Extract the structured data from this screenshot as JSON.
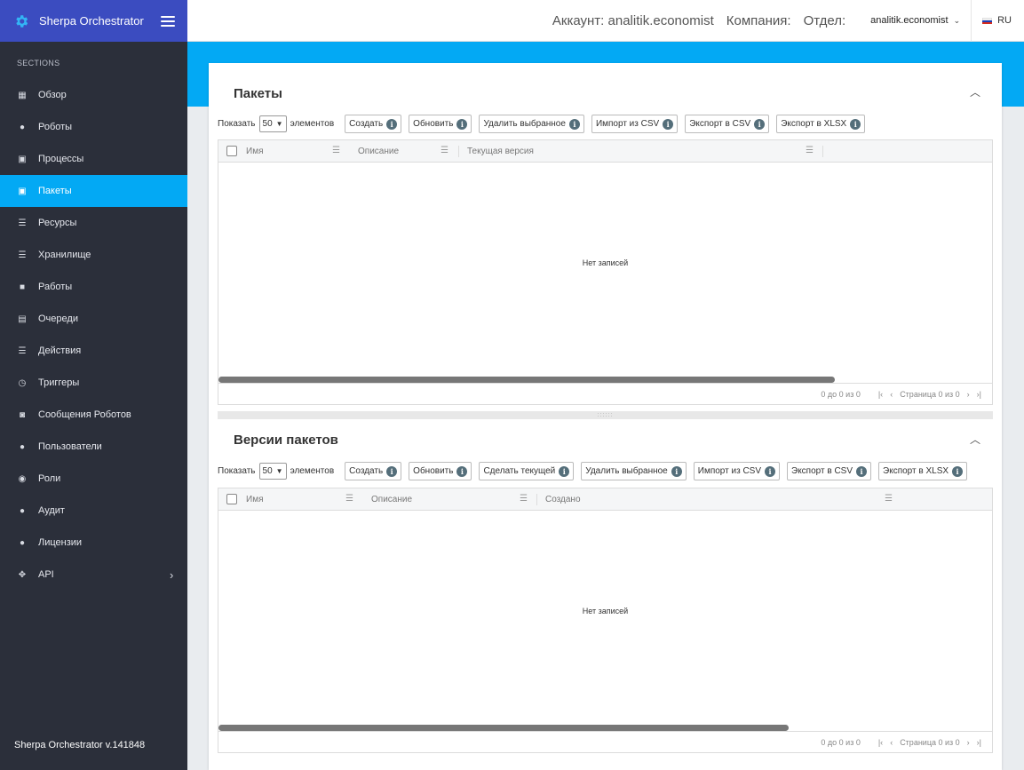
{
  "app": {
    "title": "Sherpa Orchestrator",
    "version": "Sherpa Orchestrator v.141848"
  },
  "sidebar": {
    "section_label": "SECTIONS",
    "items": [
      {
        "label": "Обзор",
        "icon": "dashboard-icon"
      },
      {
        "label": "Роботы",
        "icon": "robot-icon"
      },
      {
        "label": "Процессы",
        "icon": "process-icon"
      },
      {
        "label": "Пакеты",
        "icon": "package-icon",
        "active": true
      },
      {
        "label": "Ресурсы",
        "icon": "list-icon"
      },
      {
        "label": "Хранилище",
        "icon": "list-icon"
      },
      {
        "label": "Работы",
        "icon": "briefcase-icon"
      },
      {
        "label": "Очереди",
        "icon": "queue-icon"
      },
      {
        "label": "Действия",
        "icon": "list-icon"
      },
      {
        "label": "Триггеры",
        "icon": "clock-icon"
      },
      {
        "label": "Сообщения Роботов",
        "icon": "message-icon"
      },
      {
        "label": "Пользователи",
        "icon": "user-icon"
      },
      {
        "label": "Роли",
        "icon": "role-icon"
      },
      {
        "label": "Аудит",
        "icon": "audit-icon"
      },
      {
        "label": "Лицензии",
        "icon": "license-icon"
      },
      {
        "label": "API",
        "icon": "api-icon"
      }
    ]
  },
  "topbar": {
    "account": "Аккаунт: analitik.economist",
    "company": "Компания:",
    "department": "Отдел:",
    "user": "analitik.economist",
    "lang": "RU"
  },
  "packages": {
    "title": "Пакеты",
    "show_label": "Показать",
    "page_size": "50",
    "items_label": "элементов",
    "buttons": [
      "Создать",
      "Обновить",
      "Удалить выбранное",
      "Импорт из CSV",
      "Экспорт в CSV",
      "Экспорт в XLSX"
    ],
    "columns": [
      "Имя",
      "Описание",
      "Текущая версия"
    ],
    "empty": "Нет записей",
    "paging": "0 до 0 из 0",
    "page_info": "Страница 0 из 0",
    "scroll_fraction": 0.795
  },
  "versions": {
    "title": "Версии пакетов",
    "show_label": "Показать",
    "page_size": "50",
    "items_label": "элементов",
    "buttons": [
      "Создать",
      "Обновить",
      "Сделать текущей",
      "Удалить выбранное",
      "Импорт из CSV",
      "Экспорт в CSV",
      "Экспорт в XLSX"
    ],
    "columns": [
      "Имя",
      "Описание",
      "Создано"
    ],
    "empty": "Нет записей",
    "paging": "0 до 0 из 0",
    "page_info": "Страница 0 из 0",
    "scroll_fraction": 0.735
  },
  "colors": {
    "accent": "#03a9f4",
    "brand": "#3b4cc0",
    "sidebar": "#2b2f3a"
  }
}
